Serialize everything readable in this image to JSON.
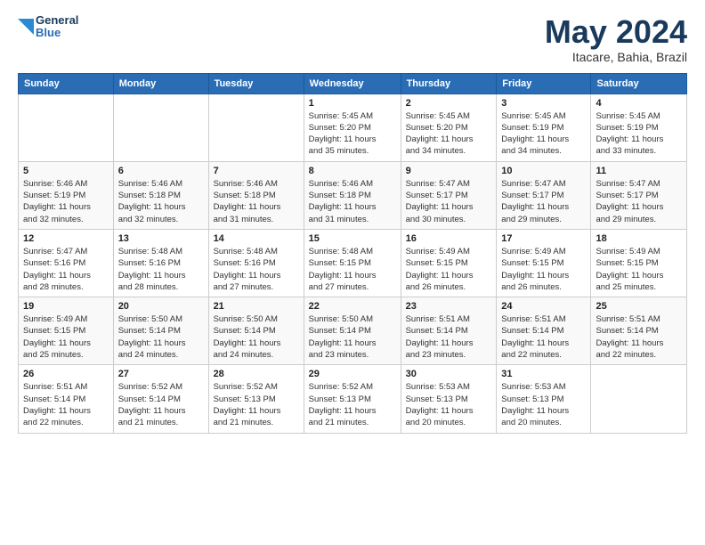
{
  "logo": {
    "line1": "General",
    "line2": "Blue"
  },
  "header": {
    "month": "May 2024",
    "location": "Itacare, Bahia, Brazil"
  },
  "days_of_week": [
    "Sunday",
    "Monday",
    "Tuesday",
    "Wednesday",
    "Thursday",
    "Friday",
    "Saturday"
  ],
  "weeks": [
    [
      {
        "day": "",
        "info": ""
      },
      {
        "day": "",
        "info": ""
      },
      {
        "day": "",
        "info": ""
      },
      {
        "day": "1",
        "info": "Sunrise: 5:45 AM\nSunset: 5:20 PM\nDaylight: 11 hours\nand 35 minutes."
      },
      {
        "day": "2",
        "info": "Sunrise: 5:45 AM\nSunset: 5:20 PM\nDaylight: 11 hours\nand 34 minutes."
      },
      {
        "day": "3",
        "info": "Sunrise: 5:45 AM\nSunset: 5:19 PM\nDaylight: 11 hours\nand 34 minutes."
      },
      {
        "day": "4",
        "info": "Sunrise: 5:45 AM\nSunset: 5:19 PM\nDaylight: 11 hours\nand 33 minutes."
      }
    ],
    [
      {
        "day": "5",
        "info": "Sunrise: 5:46 AM\nSunset: 5:19 PM\nDaylight: 11 hours\nand 32 minutes."
      },
      {
        "day": "6",
        "info": "Sunrise: 5:46 AM\nSunset: 5:18 PM\nDaylight: 11 hours\nand 32 minutes."
      },
      {
        "day": "7",
        "info": "Sunrise: 5:46 AM\nSunset: 5:18 PM\nDaylight: 11 hours\nand 31 minutes."
      },
      {
        "day": "8",
        "info": "Sunrise: 5:46 AM\nSunset: 5:18 PM\nDaylight: 11 hours\nand 31 minutes."
      },
      {
        "day": "9",
        "info": "Sunrise: 5:47 AM\nSunset: 5:17 PM\nDaylight: 11 hours\nand 30 minutes."
      },
      {
        "day": "10",
        "info": "Sunrise: 5:47 AM\nSunset: 5:17 PM\nDaylight: 11 hours\nand 29 minutes."
      },
      {
        "day": "11",
        "info": "Sunrise: 5:47 AM\nSunset: 5:17 PM\nDaylight: 11 hours\nand 29 minutes."
      }
    ],
    [
      {
        "day": "12",
        "info": "Sunrise: 5:47 AM\nSunset: 5:16 PM\nDaylight: 11 hours\nand 28 minutes."
      },
      {
        "day": "13",
        "info": "Sunrise: 5:48 AM\nSunset: 5:16 PM\nDaylight: 11 hours\nand 28 minutes."
      },
      {
        "day": "14",
        "info": "Sunrise: 5:48 AM\nSunset: 5:16 PM\nDaylight: 11 hours\nand 27 minutes."
      },
      {
        "day": "15",
        "info": "Sunrise: 5:48 AM\nSunset: 5:15 PM\nDaylight: 11 hours\nand 27 minutes."
      },
      {
        "day": "16",
        "info": "Sunrise: 5:49 AM\nSunset: 5:15 PM\nDaylight: 11 hours\nand 26 minutes."
      },
      {
        "day": "17",
        "info": "Sunrise: 5:49 AM\nSunset: 5:15 PM\nDaylight: 11 hours\nand 26 minutes."
      },
      {
        "day": "18",
        "info": "Sunrise: 5:49 AM\nSunset: 5:15 PM\nDaylight: 11 hours\nand 25 minutes."
      }
    ],
    [
      {
        "day": "19",
        "info": "Sunrise: 5:49 AM\nSunset: 5:15 PM\nDaylight: 11 hours\nand 25 minutes."
      },
      {
        "day": "20",
        "info": "Sunrise: 5:50 AM\nSunset: 5:14 PM\nDaylight: 11 hours\nand 24 minutes."
      },
      {
        "day": "21",
        "info": "Sunrise: 5:50 AM\nSunset: 5:14 PM\nDaylight: 11 hours\nand 24 minutes."
      },
      {
        "day": "22",
        "info": "Sunrise: 5:50 AM\nSunset: 5:14 PM\nDaylight: 11 hours\nand 23 minutes."
      },
      {
        "day": "23",
        "info": "Sunrise: 5:51 AM\nSunset: 5:14 PM\nDaylight: 11 hours\nand 23 minutes."
      },
      {
        "day": "24",
        "info": "Sunrise: 5:51 AM\nSunset: 5:14 PM\nDaylight: 11 hours\nand 22 minutes."
      },
      {
        "day": "25",
        "info": "Sunrise: 5:51 AM\nSunset: 5:14 PM\nDaylight: 11 hours\nand 22 minutes."
      }
    ],
    [
      {
        "day": "26",
        "info": "Sunrise: 5:51 AM\nSunset: 5:14 PM\nDaylight: 11 hours\nand 22 minutes."
      },
      {
        "day": "27",
        "info": "Sunrise: 5:52 AM\nSunset: 5:14 PM\nDaylight: 11 hours\nand 21 minutes."
      },
      {
        "day": "28",
        "info": "Sunrise: 5:52 AM\nSunset: 5:13 PM\nDaylight: 11 hours\nand 21 minutes."
      },
      {
        "day": "29",
        "info": "Sunrise: 5:52 AM\nSunset: 5:13 PM\nDaylight: 11 hours\nand 21 minutes."
      },
      {
        "day": "30",
        "info": "Sunrise: 5:53 AM\nSunset: 5:13 PM\nDaylight: 11 hours\nand 20 minutes."
      },
      {
        "day": "31",
        "info": "Sunrise: 5:53 AM\nSunset: 5:13 PM\nDaylight: 11 hours\nand 20 minutes."
      },
      {
        "day": "",
        "info": ""
      }
    ]
  ]
}
